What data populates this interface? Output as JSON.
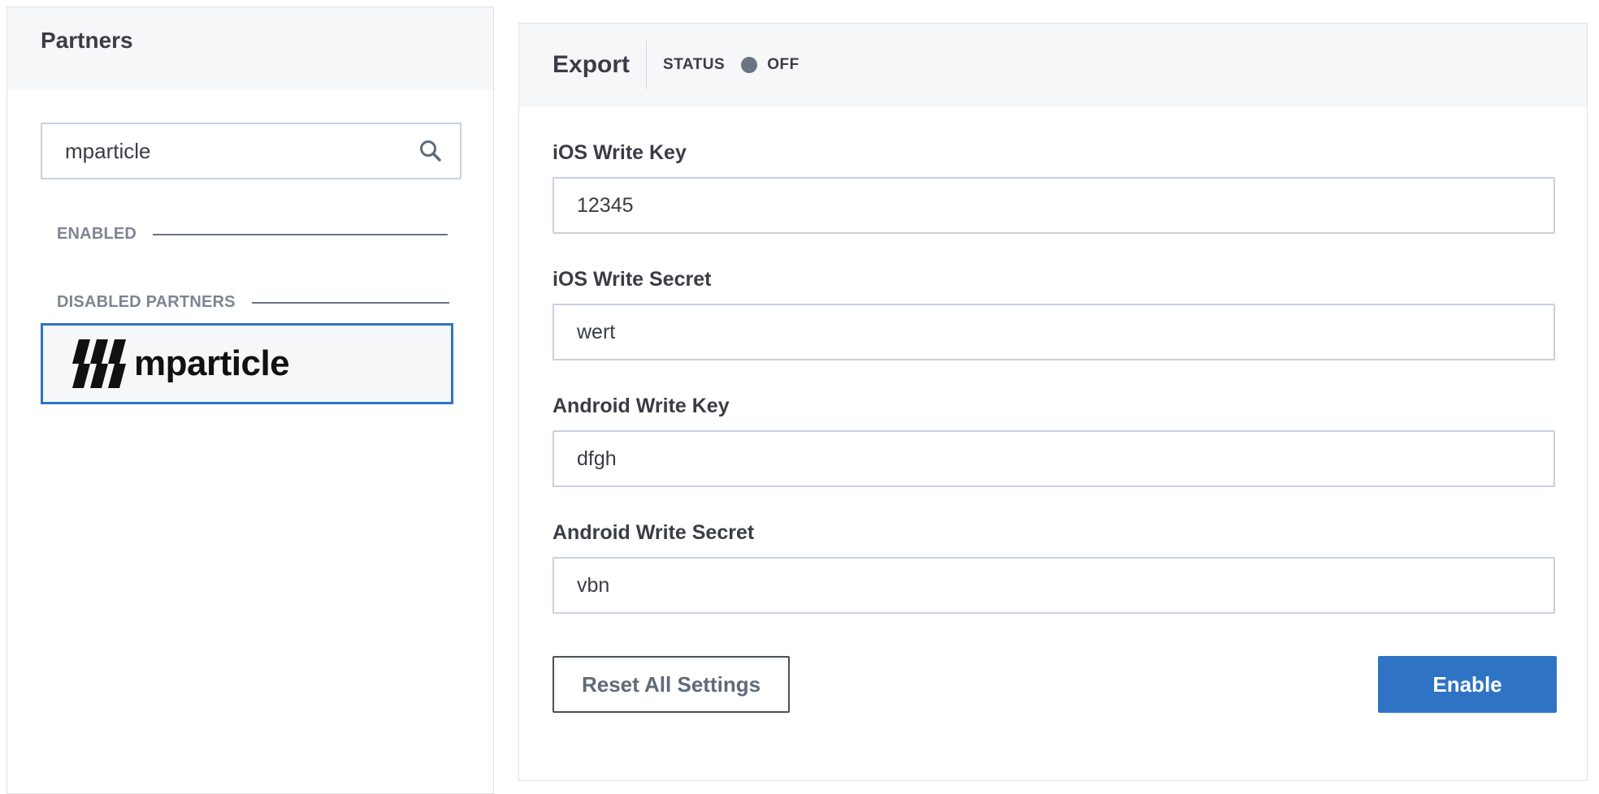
{
  "partners_panel": {
    "title": "Partners",
    "search": {
      "value": "mparticle",
      "icon": "search-icon"
    },
    "sections": {
      "enabled_label": "ENABLED",
      "disabled_label": "DISABLED PARTNERS"
    },
    "disabled_partners": [
      {
        "name": "mparticle",
        "logo_icon": "mparticle-logo-icon"
      }
    ]
  },
  "export_panel": {
    "title": "Export",
    "status_label": "STATUS",
    "status_value": "OFF",
    "status_color": "#6c7384",
    "fields": [
      {
        "label": "iOS Write Key",
        "value": "12345"
      },
      {
        "label": "iOS Write Secret",
        "value": "wert"
      },
      {
        "label": "Android Write Key",
        "value": "dfgh"
      },
      {
        "label": "Android Write Secret",
        "value": "vbn"
      }
    ],
    "reset_label": "Reset All Settings",
    "enable_label": "Enable",
    "accent_color": "#2f74c4"
  }
}
